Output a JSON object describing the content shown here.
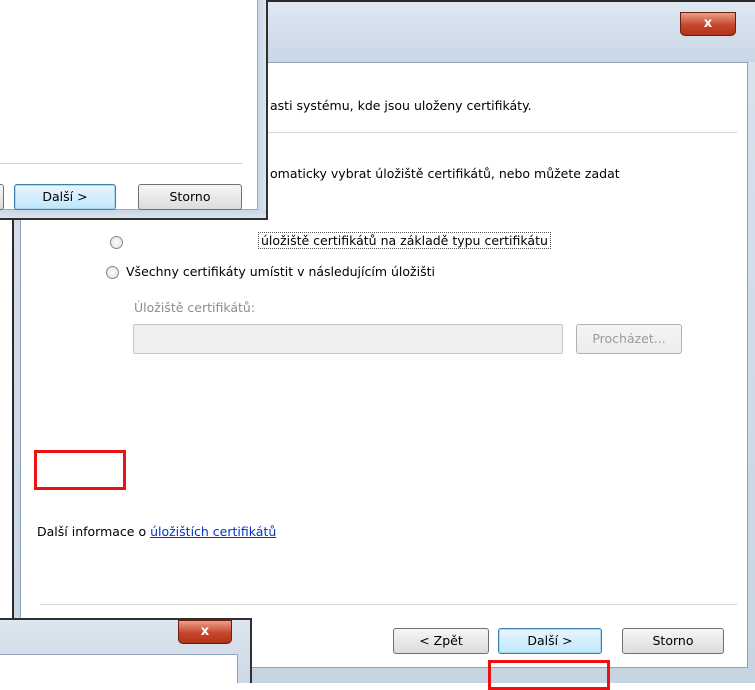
{
  "main_dialog": {
    "close_glyph": "x",
    "line_store_location": "asti systému, kde jsou uloženy certifikáty.",
    "line_auto_select": "omaticky vybrat úložiště certifikátů, nebo můžete zadat",
    "option_auto_label": "úložiště certifikátů na základě typu certifikátu",
    "option_place_all_label": "Všechny certifikáty umístit v následujícím úložišti",
    "store_field_label": "Úložiště certifikátů:",
    "store_field_value": "",
    "browse_button": "Procházet...",
    "more_info_prefix": "Další informace o ",
    "more_info_link": "úložištích certifikátů",
    "back_button": "< Zpět",
    "next_button": "Další >",
    "cancel_button": "Storno"
  },
  "background_dialog_top": {
    "next_button": "Další >",
    "cancel_button": "Storno"
  },
  "background_dialog_bottom": {
    "close_glyph": "x"
  },
  "colors": {
    "highlight": "#ee1111",
    "link": "#0033cc"
  }
}
